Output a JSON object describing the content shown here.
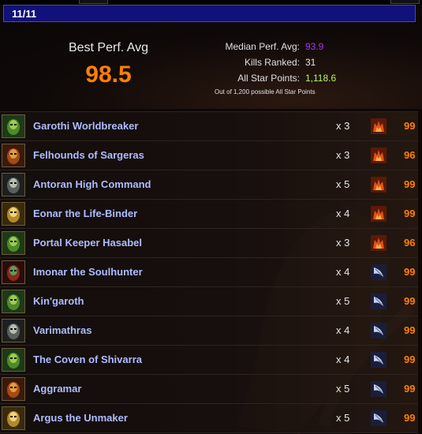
{
  "header": {
    "title": "11/11"
  },
  "summary": {
    "best_label": "Best Perf. Avg",
    "best_value": "98.5",
    "median_label": "Median Perf. Avg:",
    "median_value": "93.9",
    "kills_label": "Kills Ranked:",
    "kills_value": "31",
    "star_label": "All Star Points:",
    "star_value": "1,118.6",
    "star_note": "Out of 1,200 possible All Star Points"
  },
  "colors": {
    "header_bg": "#11117a",
    "best": "#ff8000",
    "median": "#a335ee",
    "star": "#b6f36b",
    "boss_name": "#aebcff",
    "score": "#ff8000"
  },
  "bosses": [
    {
      "name": "Garothi Worldbreaker",
      "kills": "x 3",
      "spec_icon": "fire-spec-icon",
      "score": "99",
      "portrait": "green-portrait"
    },
    {
      "name": "Felhounds of Sargeras",
      "kills": "x 3",
      "spec_icon": "fire-spec-icon",
      "score": "96",
      "portrait": "orange-portrait"
    },
    {
      "name": "Antoran High Command",
      "kills": "x 5",
      "spec_icon": "fire-spec-icon",
      "score": "99",
      "portrait": "gray-portrait"
    },
    {
      "name": "Eonar the Life-Binder",
      "kills": "x 4",
      "spec_icon": "fire-spec-icon",
      "score": "99",
      "portrait": "gold-portrait"
    },
    {
      "name": "Portal Keeper Hasabel",
      "kills": "x 3",
      "spec_icon": "fire-spec-icon",
      "score": "96",
      "portrait": "green-portrait"
    },
    {
      "name": "Imonar the Soulhunter",
      "kills": "x 4",
      "spec_icon": "frost-spec-icon",
      "score": "99",
      "portrait": "red-portrait"
    },
    {
      "name": "Kin'garoth",
      "kills": "x 5",
      "spec_icon": "frost-spec-icon",
      "score": "99",
      "portrait": "green-portrait"
    },
    {
      "name": "Varimathras",
      "kills": "x 4",
      "spec_icon": "frost-spec-icon",
      "score": "99",
      "portrait": "gray-portrait"
    },
    {
      "name": "The Coven of Shivarra",
      "kills": "x 4",
      "spec_icon": "frost-spec-icon",
      "score": "99",
      "portrait": "green-portrait"
    },
    {
      "name": "Aggramar",
      "kills": "x 5",
      "spec_icon": "frost-spec-icon",
      "score": "99",
      "portrait": "orange-portrait"
    },
    {
      "name": "Argus the Unmaker",
      "kills": "x 5",
      "spec_icon": "frost-spec-icon",
      "score": "99",
      "portrait": "gold-portrait"
    }
  ]
}
